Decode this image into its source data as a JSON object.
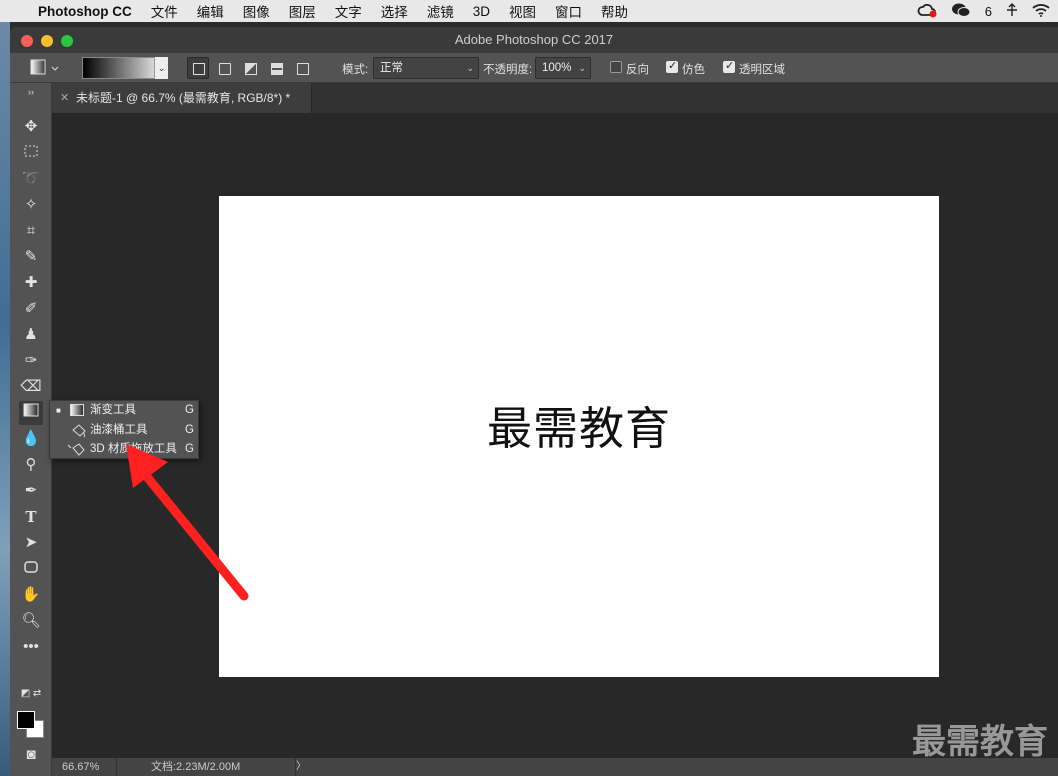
{
  "menubar": {
    "app": "Photoshop CC",
    "items": [
      "文件",
      "编辑",
      "图像",
      "图层",
      "文字",
      "选择",
      "滤镜",
      "3D",
      "视图",
      "窗口",
      "帮助"
    ],
    "right": {
      "notification_count": "6"
    }
  },
  "window": {
    "title": "Adobe Photoshop CC 2017"
  },
  "options": {
    "mode_label": "模式:",
    "mode_value": "正常",
    "opacity_label": "不透明度:",
    "opacity_value": "100%",
    "reverse_label": "反向",
    "reverse_checked": false,
    "dither_label": "仿色",
    "dither_checked": true,
    "transparency_label": "透明区域",
    "transparency_checked": true
  },
  "document": {
    "tab_title": "未标题-1 @ 66.7% (最需教育, RGB/8*) *",
    "canvas_text": "最需教育"
  },
  "flyout": {
    "items": [
      {
        "label": "渐变工具",
        "shortcut": "G",
        "active": true,
        "icon": "gradient-icon"
      },
      {
        "label": "油漆桶工具",
        "shortcut": "G",
        "active": false,
        "icon": "paint-bucket-icon"
      },
      {
        "label": "3D 材质拖放工具",
        "shortcut": "G",
        "active": false,
        "icon": "3d-material-drop-icon"
      }
    ]
  },
  "status": {
    "zoom": "66.67%",
    "doc_info": "文档:2.23M/2.00M",
    "more": "〉"
  },
  "watermark": "最需教育",
  "colors": {
    "foreground": "#000000",
    "background": "#ffffff",
    "annotation_arrow": "#ff2020"
  }
}
